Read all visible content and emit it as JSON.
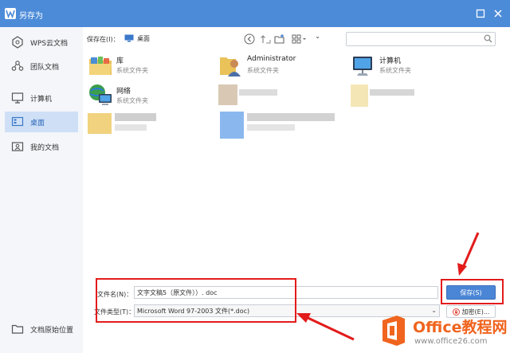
{
  "window": {
    "title": "另存为"
  },
  "sidebar": {
    "items": [
      {
        "label": "WPS云文档"
      },
      {
        "label": "团队文档"
      },
      {
        "label": "计算机"
      },
      {
        "label": "桌面"
      },
      {
        "label": "我的文档"
      }
    ],
    "bottom_label": "文档原始位置"
  },
  "toolbar": {
    "save_in_label": "保存在(I)：",
    "location": "桌面"
  },
  "files": [
    {
      "name": "库",
      "type": "系统文件夹"
    },
    {
      "name": "Administrator",
      "type": "系统文件夹"
    },
    {
      "name": "计算机",
      "type": "系统文件夹"
    },
    {
      "name": "网络",
      "type": "系统文件夹"
    }
  ],
  "form": {
    "filename_label": "文件名(N)：",
    "filename_value": "文字文稿5（原文件））. doc",
    "filetype_label": "文件类型(T)：",
    "filetype_value": "Microsoft Word 97-2003 文件(*.doc)",
    "save_label": "保存(S)",
    "encrypt_label": "加密(E)..."
  },
  "watermark": {
    "line1": "Office教程网",
    "line2": "www.office26.com"
  },
  "colors": {
    "titlebar": "#4c8bd8",
    "save_button": "#4b86d6",
    "annotation": "#e31b1b",
    "watermark_orange": "#f0641e"
  }
}
